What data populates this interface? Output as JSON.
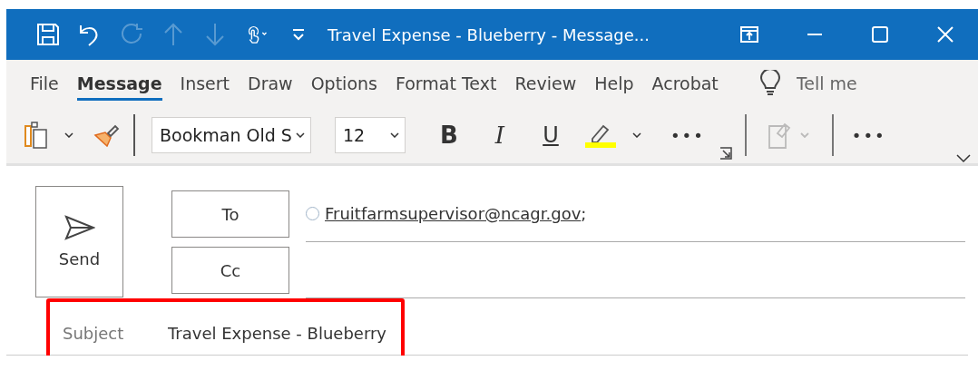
{
  "window": {
    "title": "Travel Expense - Blueberry  -  Message..."
  },
  "quick_access": [
    {
      "kind": "save",
      "disabled": false
    },
    {
      "kind": "undo",
      "disabled": false
    },
    {
      "kind": "redo",
      "disabled": true
    },
    {
      "kind": "up",
      "disabled": true
    },
    {
      "kind": "down",
      "disabled": true
    },
    {
      "kind": "touch",
      "disabled": false
    },
    {
      "kind": "customize",
      "disabled": false
    }
  ],
  "tabs": [
    {
      "label": "File",
      "selected": false
    },
    {
      "label": "Message",
      "selected": true
    },
    {
      "label": "Insert",
      "selected": false
    },
    {
      "label": "Draw",
      "selected": false
    },
    {
      "label": "Options",
      "selected": false
    },
    {
      "label": "Format Text",
      "selected": false
    },
    {
      "label": "Review",
      "selected": false
    },
    {
      "label": "Help",
      "selected": false
    },
    {
      "label": "Acrobat",
      "selected": false
    }
  ],
  "tell_me": {
    "placeholder": "Tell me"
  },
  "toolbar": {
    "font": "Bookman Old S",
    "size": "12",
    "bold": "B",
    "italic": "I",
    "underline": "U",
    "more": "•••",
    "styles_disabled": true,
    "more_right": "•••"
  },
  "compose": {
    "send": "Send",
    "to_button": "To",
    "cc_button": "Cc",
    "to_recipient": "Fruitfarmsupervisor@ncagr.gov",
    "to_separator": ";",
    "subject_label": "Subject",
    "subject": "Travel Expense - Blueberry",
    "subject_highlighted": true
  }
}
